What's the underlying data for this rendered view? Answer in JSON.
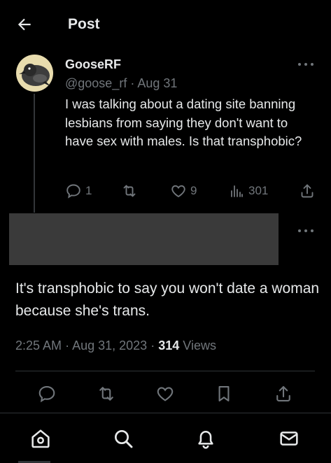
{
  "header": {
    "title": "Post",
    "back_icon": "arrow-left-icon"
  },
  "reply": {
    "display_name": "GooseRF",
    "handle": "@goose_rf",
    "separator": "·",
    "date": "Aug 31",
    "text": "I was talking about a dating site banning lesbians from saying they don't want to have sex with males. Is that transphobic?",
    "stats": {
      "replies": "1",
      "reposts": "",
      "likes": "9",
      "views": "301"
    }
  },
  "main_post": {
    "text": "It's transphobic to say you won't date a woman because she's trans.",
    "time": "2:25 AM",
    "dot1": "·",
    "date": "Aug 31, 2023",
    "dot2": "·",
    "views_count": "314",
    "views_label": "Views"
  },
  "bottom_nav": [
    "home-icon",
    "search-icon",
    "notifications-icon",
    "messages-icon"
  ],
  "colors": {
    "background": "#000000",
    "text": "#e7e9ea",
    "muted": "#71767b",
    "divider": "#2f3336",
    "redacted": "#3a3a3a"
  }
}
